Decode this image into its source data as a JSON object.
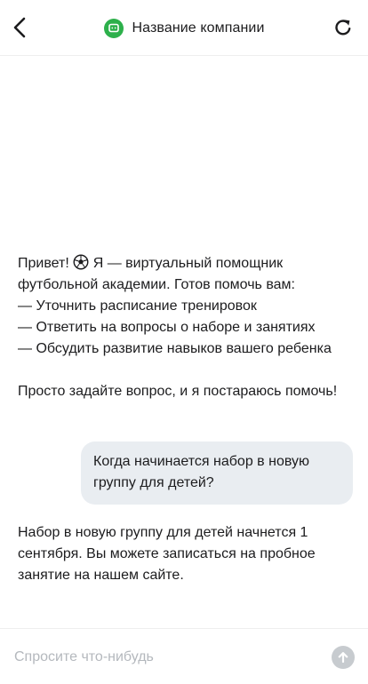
{
  "header": {
    "company_name": "Название компании",
    "back_icon": "chevron-left-icon",
    "refresh_icon": "refresh-icon",
    "logo_icon": "chat-bubble-icon",
    "accent_color": "#2db04b"
  },
  "messages": [
    {
      "role": "bot",
      "greeting": "Привет!",
      "emoji": "soccer-ball-icon",
      "text_after_emoji": " Я — виртуальный помощник футбольной академии. Готов помочь вам:\n— Уточнить расписание тренировок\n— Ответить на вопросы о наборе и занятиях\n— Обсудить развитие навыков вашего ребенка\n\nПросто задайте вопрос, и я постараюсь помочь!"
    },
    {
      "role": "user",
      "text": "Когда начинается набор в новую группу для детей?"
    },
    {
      "role": "bot",
      "text": "Набор в новую группу для детей начнется 1 сентября. Вы можете записаться на пробное занятие на нашем сайте."
    }
  ],
  "composer": {
    "placeholder": "Спросите что-нибудь",
    "value": "",
    "send_icon": "arrow-up-icon"
  }
}
